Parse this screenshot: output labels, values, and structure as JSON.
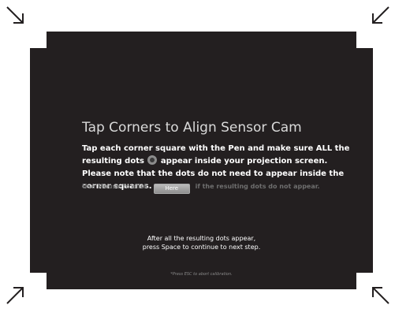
{
  "title": "Tap Corners to Align Sensor Cam",
  "instructions": {
    "part1": "Tap each corner square with the Pen and make sure ALL the resulting dots",
    "part2": "appear inside your projection screen. Please note that the dots do not need to appear inside the corner squares."
  },
  "mouse_hint": {
    "before": "Use Mouse to click",
    "button_label": "Here",
    "after": "if the resulting dots do not appear."
  },
  "continue_text": {
    "line1": "After all the resulting dots appear,",
    "line2": "press Space to continue to next step."
  },
  "escape_note": "*Press ESC to abort calibration.",
  "colors": {
    "screen_background": "#231f20",
    "corner_square": "#ffffff",
    "arrow": "#231f20"
  },
  "icons": {
    "corner_arrows": [
      "arrow-down-right-icon",
      "arrow-down-left-icon",
      "arrow-up-right-icon",
      "arrow-up-left-icon"
    ],
    "dot": "calibration-dot-icon"
  }
}
